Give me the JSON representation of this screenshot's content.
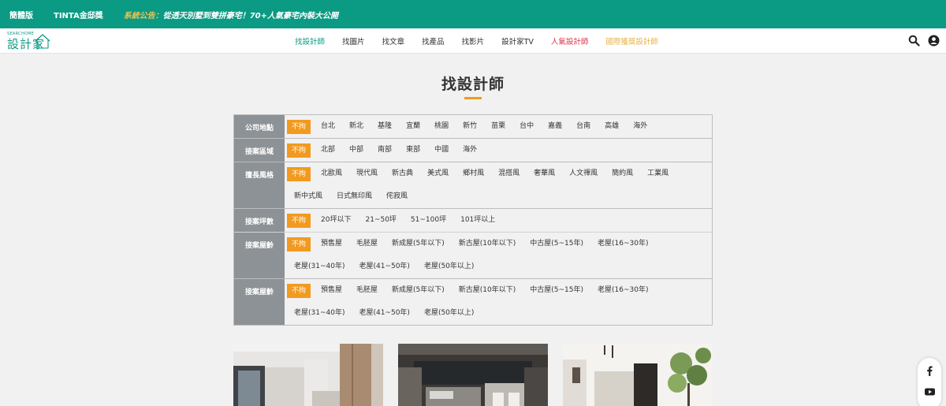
{
  "topbar": {
    "links": [
      "簡體版",
      "TINTA金邸獎"
    ],
    "announcement_label": "系統公告：",
    "announcement_text": "從透天別墅到雙拼豪宅！70+人氣豪宅內裝大公開"
  },
  "logo": {
    "small_text": "SEARCHOME",
    "main_text": "設計家"
  },
  "nav": {
    "items": [
      "找設計師",
      "找圖片",
      "找文章",
      "找產品",
      "找影片",
      "設計家TV",
      "人氣設計師",
      "國際獲獎設計師"
    ],
    "active_index": 0
  },
  "page": {
    "title": "找設計師"
  },
  "filters": {
    "any_label": "不拘",
    "rows": [
      {
        "label": "公司地點",
        "options": [
          "台北",
          "新北",
          "基隆",
          "宜蘭",
          "桃園",
          "新竹",
          "苗栗",
          "台中",
          "嘉義",
          "台南",
          "高雄",
          "海外"
        ]
      },
      {
        "label": "接案區域",
        "options": [
          "北部",
          "中部",
          "南部",
          "東部",
          "中國",
          "海外"
        ]
      },
      {
        "label": "擅長風格",
        "options": [
          "北歐風",
          "現代風",
          "新古典",
          "美式風",
          "鄉村風",
          "混搭風",
          "奢華風",
          "人文禪風",
          "簡約風",
          "工業風",
          "新中式風",
          "日式無印風",
          "侘寂風"
        ]
      },
      {
        "label": "接案坪數",
        "options": [
          "20坪以下",
          "21~50坪",
          "51~100坪",
          "101坪以上"
        ]
      },
      {
        "label": "接案屋齡",
        "options": [
          "預售屋",
          "毛胚屋",
          "新成屋(5年以下)",
          "新古屋(10年以下)",
          "中古屋(5~15年)",
          "老屋(16~30年)",
          "老屋(31~40年)",
          "老屋(41~50年)",
          "老屋(50年以上)"
        ]
      },
      {
        "label": "接案屋齡",
        "options": [
          "預售屋",
          "毛胚屋",
          "新成屋(5年以下)",
          "新古屋(10年以下)",
          "中古屋(5~15年)",
          "老屋(16~30年)",
          "老屋(31~40年)",
          "老屋(41~50年)",
          "老屋(50年以上)"
        ]
      }
    ]
  },
  "colors": {
    "brand": "#0b9a84",
    "accent": "#f29a1f",
    "label_bg": "#8d9296",
    "hot": "#d9364a",
    "award": "#e9b24a"
  },
  "icons": {
    "header": [
      "search-icon",
      "user-icon"
    ],
    "social": [
      "facebook-icon",
      "youtube-icon"
    ]
  }
}
